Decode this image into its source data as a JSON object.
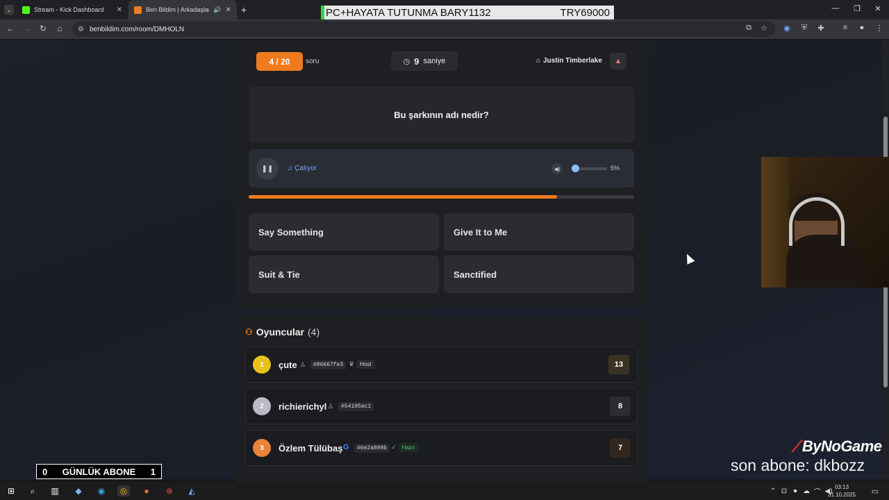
{
  "browser": {
    "tabs": [
      {
        "title": "Stream - Kick Dashboard",
        "icon": "kick-icon"
      },
      {
        "title": "Ben Bildim | Arkadaşlarınla",
        "icon": "benbildim-icon"
      }
    ],
    "new_tab": "+",
    "url": "benbildim.com/room/DMHOLN"
  },
  "ticker": {
    "left": "PC+HAYATA TUTUNMA BARY1132",
    "right": "TRY69000"
  },
  "quiz": {
    "progress_label": "4 / 20",
    "progress_suffix": "soru",
    "timer_value": "9",
    "timer_unit": "saniye",
    "artist": "Justin Timberlake",
    "question": "Bu şarkının adı nedir?",
    "playing_label": "Çalıyor",
    "volume_label": "5%",
    "volume_fraction": 0.05,
    "time_progress_fraction": 0.8,
    "answers": [
      "Say Something",
      "Give It to Me",
      "Suit & Tie",
      "Sanctified"
    ]
  },
  "players": {
    "title": "Oyuncular",
    "count": "(4)",
    "rows": [
      {
        "rank": "1",
        "name": "çute",
        "tag": "#86667fe3",
        "badge": "Host",
        "score": "13",
        "rank_color": "#e8c21c",
        "score_bg": "#3a3323"
      },
      {
        "rank": "2",
        "name": "richierichyl",
        "tag": "#54105ac1",
        "badge": "",
        "score": "8",
        "rank_color": "#b9bcc4",
        "score_bg": "#2c2d31"
      },
      {
        "rank": "3",
        "name": "Özlem Tülübaş",
        "tag": "#6e2a898b",
        "badge": "Hazır",
        "score": "7",
        "rank_color": "#e8843a",
        "score_bg": "#33261c"
      }
    ]
  },
  "overlay": {
    "sub_left": "0",
    "sub_label": "GÜNLÜK ABONE",
    "sub_right": "1",
    "brand": "ByNoGame",
    "last_sub": "son abone: dkbozz"
  },
  "taskbar": {
    "time": "03:13",
    "date": "31.10.2025"
  }
}
